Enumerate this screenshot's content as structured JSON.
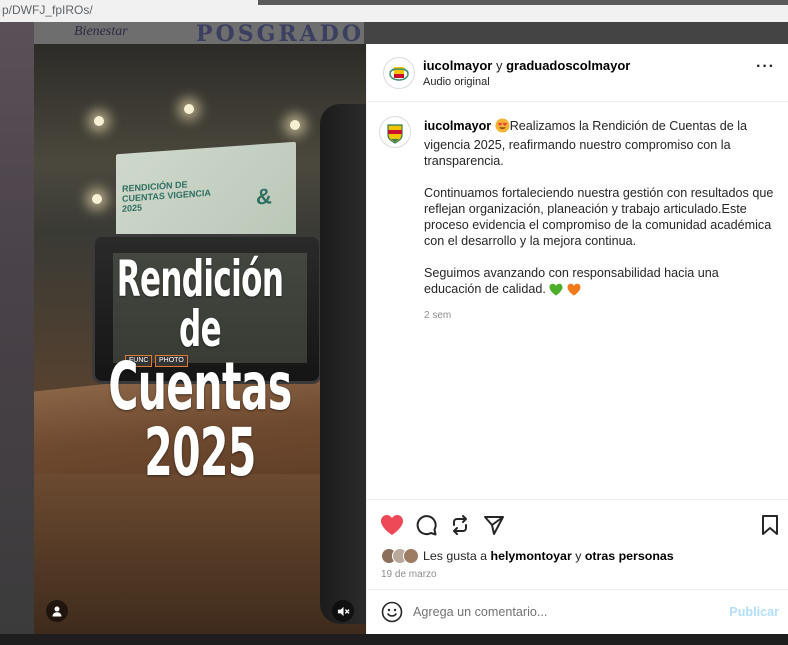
{
  "browser": {
    "url_fragment": "p/DWFJ_fpIROs/"
  },
  "background": {
    "banner_text": "Bienestar",
    "posgrados_text": "POSGRADOS"
  },
  "video": {
    "title_line1": "Rendición de",
    "title_line2": "Cuentas 2025",
    "screen_text": "RENDICIÓN DE CUENTAS VIGENCIA 2025",
    "cam_btn1": "FUNC",
    "cam_btn2": "PHOTO",
    "user_icon": "user-icon",
    "mute_icon": "volume-muted-icon"
  },
  "post": {
    "author": "iucolmayor",
    "connector": " y ",
    "coauthor": "graduadoscolmayor",
    "audio": "Audio original",
    "more": "···",
    "caption_user": "iucolmayor",
    "caption_p1": "Realizamos la Rendición de Cuentas de la vigencia 2025, reafirmando nuestro compromiso con la transparencia.",
    "caption_p2": "Continuamos fortaleciendo nuestra gestión con resultados que reflejan organización, planeación y trabajo articulado.Este proceso evidencia el compromiso de la comunidad académica con el desarrollo y la mejora continua.",
    "caption_p3": "Seguimos avanzando con responsabilidad hacia una educación de calidad.",
    "time_ago": "2 sem",
    "likes_prefix": "Les gusta a ",
    "likes_user": "helymontoyar",
    "likes_mid": " y ",
    "likes_others": "otras personas",
    "date": "19 de marzo",
    "liked": true,
    "like_color": "#ed4956"
  },
  "comment": {
    "placeholder": "Agrega un comentario...",
    "publish": "Publicar",
    "publish_color": "#b2dffc"
  }
}
